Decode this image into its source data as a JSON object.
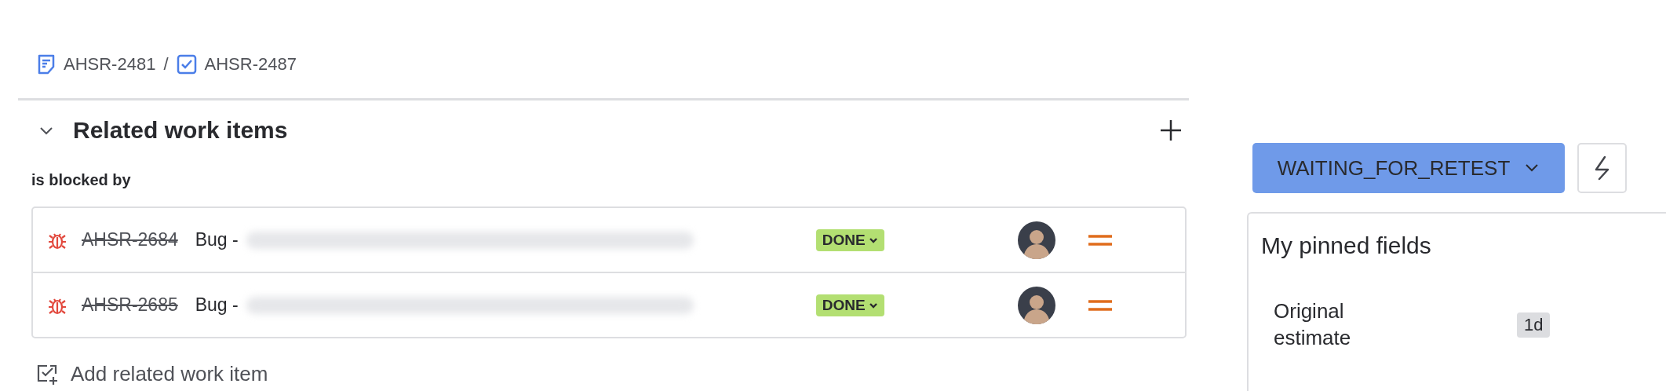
{
  "breadcrumbs": [
    {
      "key": "AHSR-2481",
      "kind": "story"
    },
    {
      "key": "AHSR-2487",
      "kind": "task"
    }
  ],
  "breadcrumb_separator": "/",
  "section": {
    "title": "Related work items",
    "expanded": true
  },
  "link_type": "is blocked by",
  "items": [
    {
      "key": "AHSR-2684",
      "resolved": true,
      "summary": "Bug -",
      "status": "DONE"
    },
    {
      "key": "AHSR-2685",
      "resolved": true,
      "summary": "Bug -",
      "status": "DONE"
    }
  ],
  "add_link": "Add related work item",
  "status_button": "WAITING_FOR_RETEST",
  "pinned": {
    "title": "My pinned fields",
    "fields": [
      {
        "label": "Original estimate",
        "value": "1d"
      }
    ]
  }
}
